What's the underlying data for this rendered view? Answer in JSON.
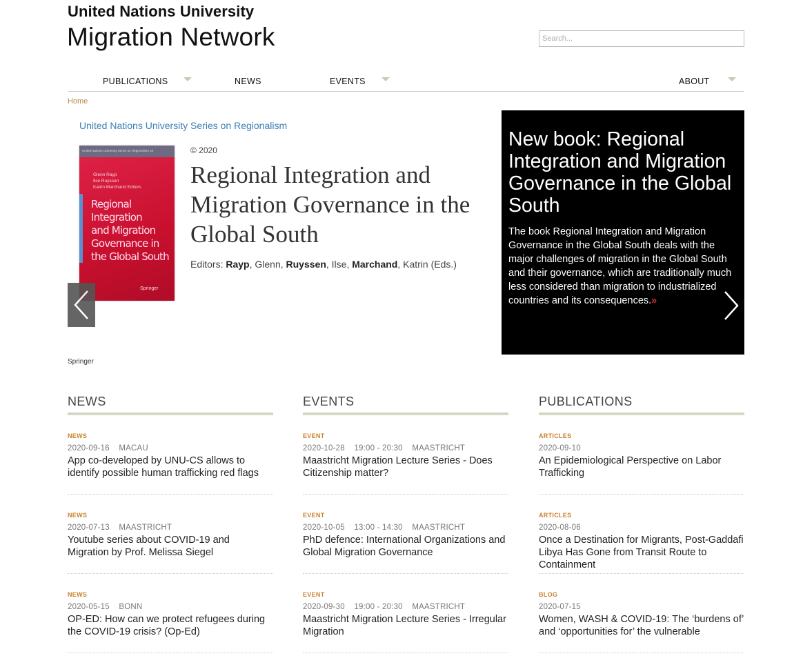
{
  "header": {
    "org": "United Nations University",
    "site": "Migration Network",
    "search_placeholder": "Search..."
  },
  "nav": {
    "publications": "PUBLICATIONS",
    "news": "NEWS",
    "events": "EVENTS",
    "about": "ABOUT"
  },
  "breadcrumb": "Home",
  "slide": {
    "series": "United Nations University Series on Regionalism",
    "cover_series": "United Nations University Series on Regionalism  18",
    "cover_editors": "Glenn Rayp\nIlse Ruyssen\nKatrin Marchand  Editors",
    "cover_title": "Regional\nIntegration\nand Migration\nGovernance in\nthe Global South",
    "cover_publisher": "Springer",
    "copyright": "© 2020",
    "book_title": "Regional Integration and Migration Governance in the Global South",
    "editors_label": "Editors:",
    "editor1_last": "Rayp",
    "editor1_first": ", Glenn,",
    "editor2_last": "Ruyssen",
    "editor2_first": ", Ilse,",
    "editor3_last": "Marchand",
    "editor3_first": ", Katrin (Eds.)",
    "publisher": "Springer",
    "heading": "New book: Regional Integration and Migration Governance in the Global South",
    "text": "The book Regional Integration and Migration Governance in the Global South deals with the major challenges of migration in the Global South and their governance, which are traditionally much less considered than migration to industrialized countries and its consequences.",
    "more": "»"
  },
  "news": {
    "title": "NEWS",
    "items": [
      {
        "type": "NEWS",
        "meta": "2020-09-16    MACAU",
        "title": "App co-developed by UNU-CS allows to identify possible human trafficking red flags"
      },
      {
        "type": "NEWS",
        "meta": "2020-07-13    MAASTRICHT",
        "title": "Youtube series about COVID-19 and Migration by Prof. Melissa Siegel"
      },
      {
        "type": "NEWS",
        "meta": "2020-05-15    BONN",
        "title": "OP-ED: How can we protect refugees during the COVID-19 crisis? (Op-Ed)"
      }
    ]
  },
  "events": {
    "title": "EVENTS",
    "items": [
      {
        "type": "EVENT",
        "meta": "2020-10-28    19:00 - 20:30    MAASTRICHT",
        "title": "Maastricht Migration Lecture Series - Does Citizenship matter?"
      },
      {
        "type": "EVENT",
        "meta": "2020-10-05    13:00 - 14:30    MAASTRICHT",
        "title": "PhD defence: International Organizations and Global Migration Governance"
      },
      {
        "type": "EVENT",
        "meta": "2020-09-30    19:00 - 20:30    MAASTRICHT",
        "title": "Maastricht Migration Lecture Series - Irregular Migration"
      }
    ]
  },
  "publications": {
    "title": "PUBLICATIONS",
    "items": [
      {
        "type": "ARTICLES",
        "meta": "2020-09-10",
        "title": "An Epidemiological Perspective on Labor Trafficking"
      },
      {
        "type": "ARTICLES",
        "meta": "2020-08-06",
        "title": "Once a Destination for Migrants, Post-Gaddafi Libya Has Gone from Transit Route to Containment"
      },
      {
        "type": "BLOG",
        "meta": "2020-07-15",
        "title": "Women, WASH & COVID-19: The ‘burdens of’ and ‘opportunities for’ the vulnerable"
      }
    ]
  }
}
